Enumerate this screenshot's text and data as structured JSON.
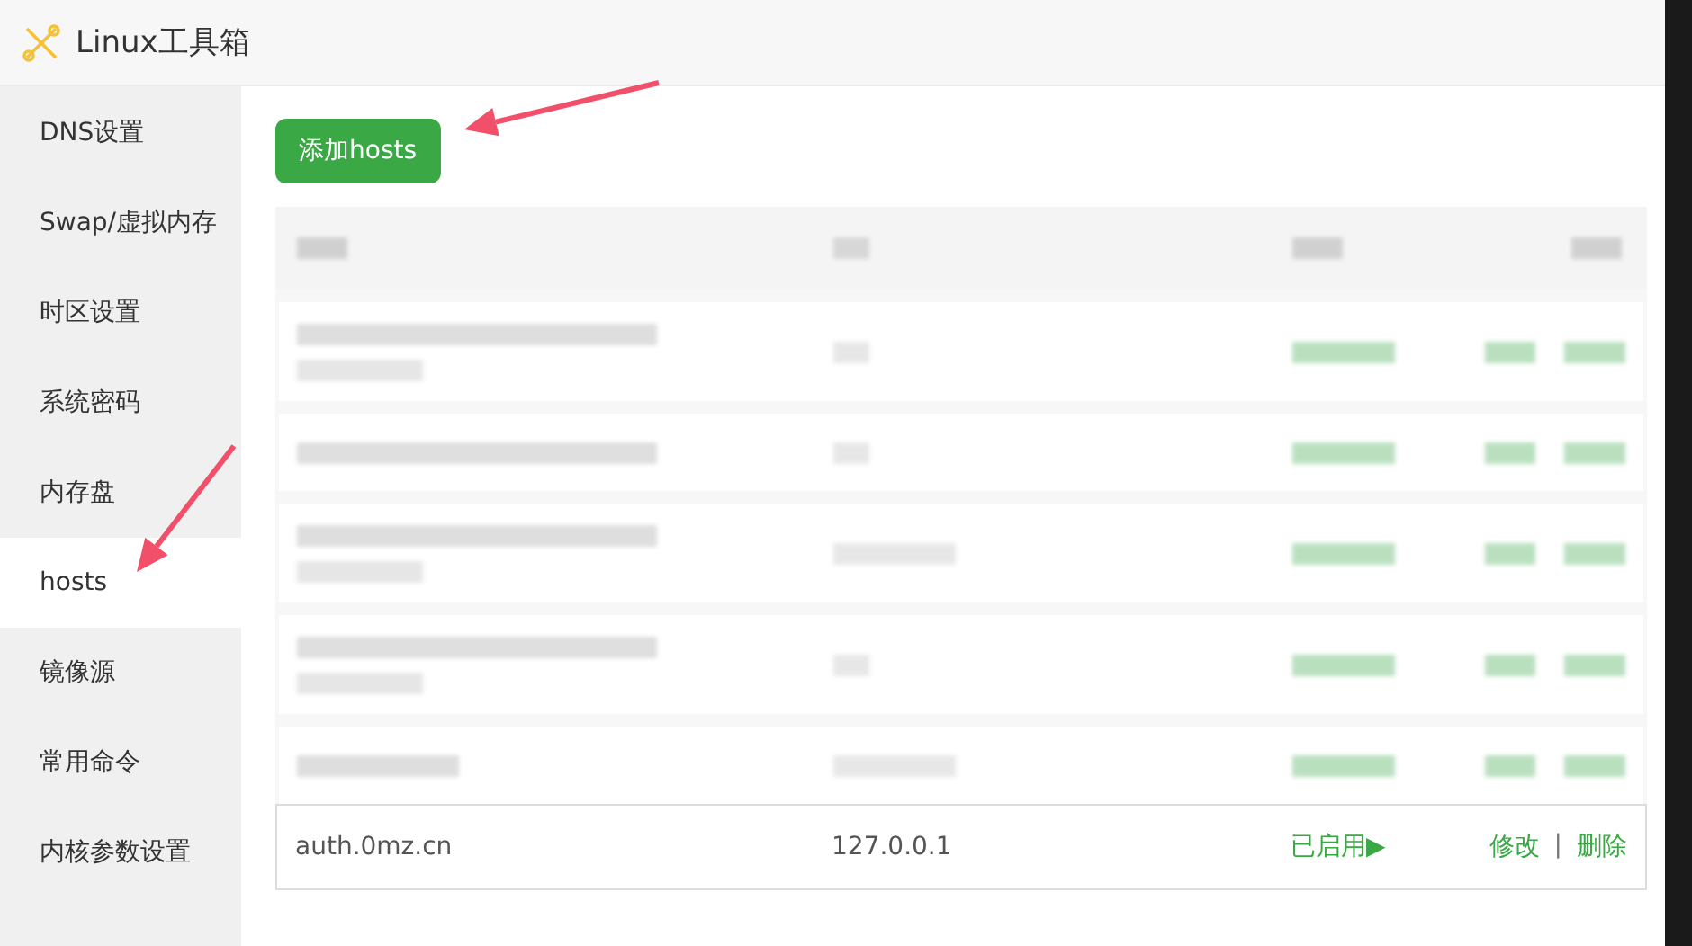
{
  "window": {
    "title": "Linux工具箱"
  },
  "sidebar": {
    "items": [
      {
        "label": "DNS设置",
        "selected": false
      },
      {
        "label": "Swap/虚拟内存",
        "selected": false
      },
      {
        "label": "时区设置",
        "selected": false
      },
      {
        "label": "系统密码",
        "selected": false
      },
      {
        "label": "内存盘",
        "selected": false
      },
      {
        "label": "hosts",
        "selected": true
      },
      {
        "label": "镜像源",
        "selected": false
      },
      {
        "label": "常用命令",
        "selected": false
      },
      {
        "label": "内核参数设置",
        "selected": false
      }
    ]
  },
  "add_button": {
    "label": "添加hosts"
  },
  "table": {
    "redacted_rows": [
      {
        "wrapped": true,
        "long_ip": false
      },
      {
        "wrapped": false,
        "long_ip": false
      },
      {
        "wrapped": true,
        "long_ip": true
      },
      {
        "wrapped": true,
        "long_ip": false
      },
      {
        "wrapped": false,
        "long_ip": true
      }
    ],
    "rows": [
      {
        "domain": "auth.0mz.cn",
        "ip": "127.0.0.1",
        "status": "已启用",
        "status_icon": "▶",
        "enabled": true,
        "actions": [
          "修改",
          "删除"
        ],
        "separator": "|"
      }
    ]
  },
  "annotations": [
    {
      "kind": "arrow"
    },
    {
      "kind": "arrow"
    }
  ]
}
